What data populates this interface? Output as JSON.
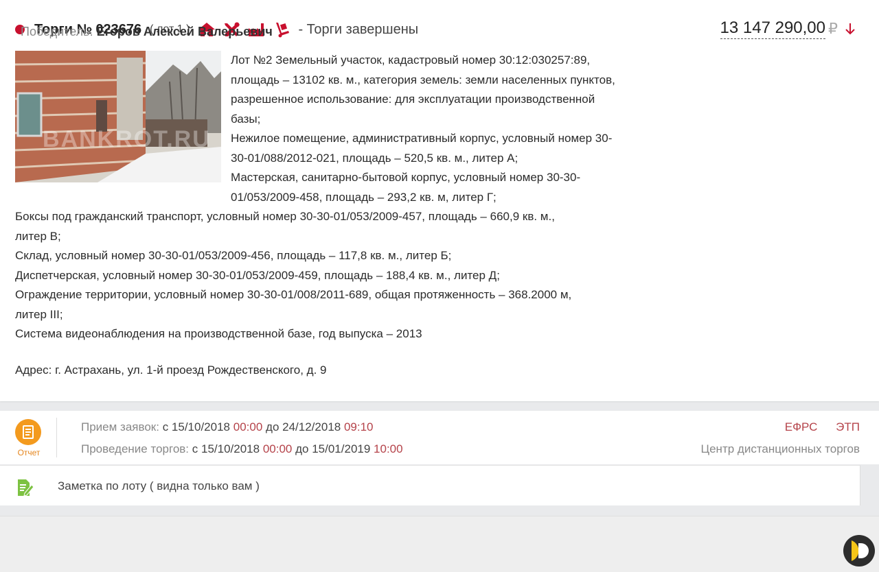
{
  "lot_card": {
    "title": "Торги № 023676",
    "lot_number": "( лот 1 )",
    "category_icons": [
      "house-icon",
      "tools-icon",
      "factory-icon",
      "hand-truck-icon"
    ],
    "status": "- Торги завершены",
    "price": "13 147 290,00",
    "currency": "₽",
    "price_trend": "down",
    "photo_watermark": "BANKROT.RU",
    "description_lines": [
      "Лот №2 Земельный участок, кадастровый номер 30:12:030257:89,",
      "площадь – 13102 кв. м., категория земель: земли населенных пунктов,",
      "разрешенное использование: для эксплуатации производственной",
      "базы;",
      "Нежилое помещение, административный корпус, условный номер 30-",
      "30-01/088/2012-021, площадь – 520,5 кв. м., литер А;",
      "Мастерская, санитарно-бытовой корпус, условный номер 30-30-",
      "01/053/2009-458, площадь – 293,2 кв. м, литер Г;",
      "Боксы под гражданский транспорт, условный номер 30-30-01/053/2009-457, площадь – 660,9 кв. м.,",
      "литер В;",
      "Склад, условный номер 30-30-01/053/2009-456, площадь – 117,8 кв. м., литер Б;",
      "Диспетчерская, условный номер 30-30-01/053/2009-459, площадь – 188,4 кв. м., литер Д;",
      "Ограждение территории, условный номер 30-30-01/008/2011-689, общая протяженность – 368.2000 м,",
      "литер III;",
      "Система видеонаблюдения на производственной базе, год выпуска – 2013"
    ],
    "address": "Адрес: г. Астрахань, ул. 1-й проезд Рождественского, д. 9"
  },
  "schedule": {
    "report_label": "Отчет",
    "applications_label": "Прием заявок:",
    "applications_from_prefix": "с",
    "applications_from_date": "15/10/2018",
    "applications_from_time": "00:00",
    "applications_to_prefix": "до",
    "applications_to_date": "24/12/2018",
    "applications_to_time": "09:10",
    "auction_label": "Проведение торгов:",
    "auction_from_prefix": "с",
    "auction_from_date": "15/10/2018",
    "auction_from_time": "00:00",
    "auction_to_prefix": "до",
    "auction_to_date": "15/01/2019",
    "auction_to_time": "10:00",
    "platform_links": [
      "ЕФРС",
      "ЭТП"
    ],
    "platform_name": "Центр дистанционных торгов"
  },
  "note": {
    "text": "Заметка по лоту ( видна только вам )"
  },
  "winner": {
    "label": "Победитель:",
    "name": "Егоров Алексей Валерьевич"
  },
  "colors": {
    "accent_red": "#c8102e",
    "time_red": "#b5434a",
    "report_orange": "#f39a1e",
    "note_green": "#7dc242"
  }
}
